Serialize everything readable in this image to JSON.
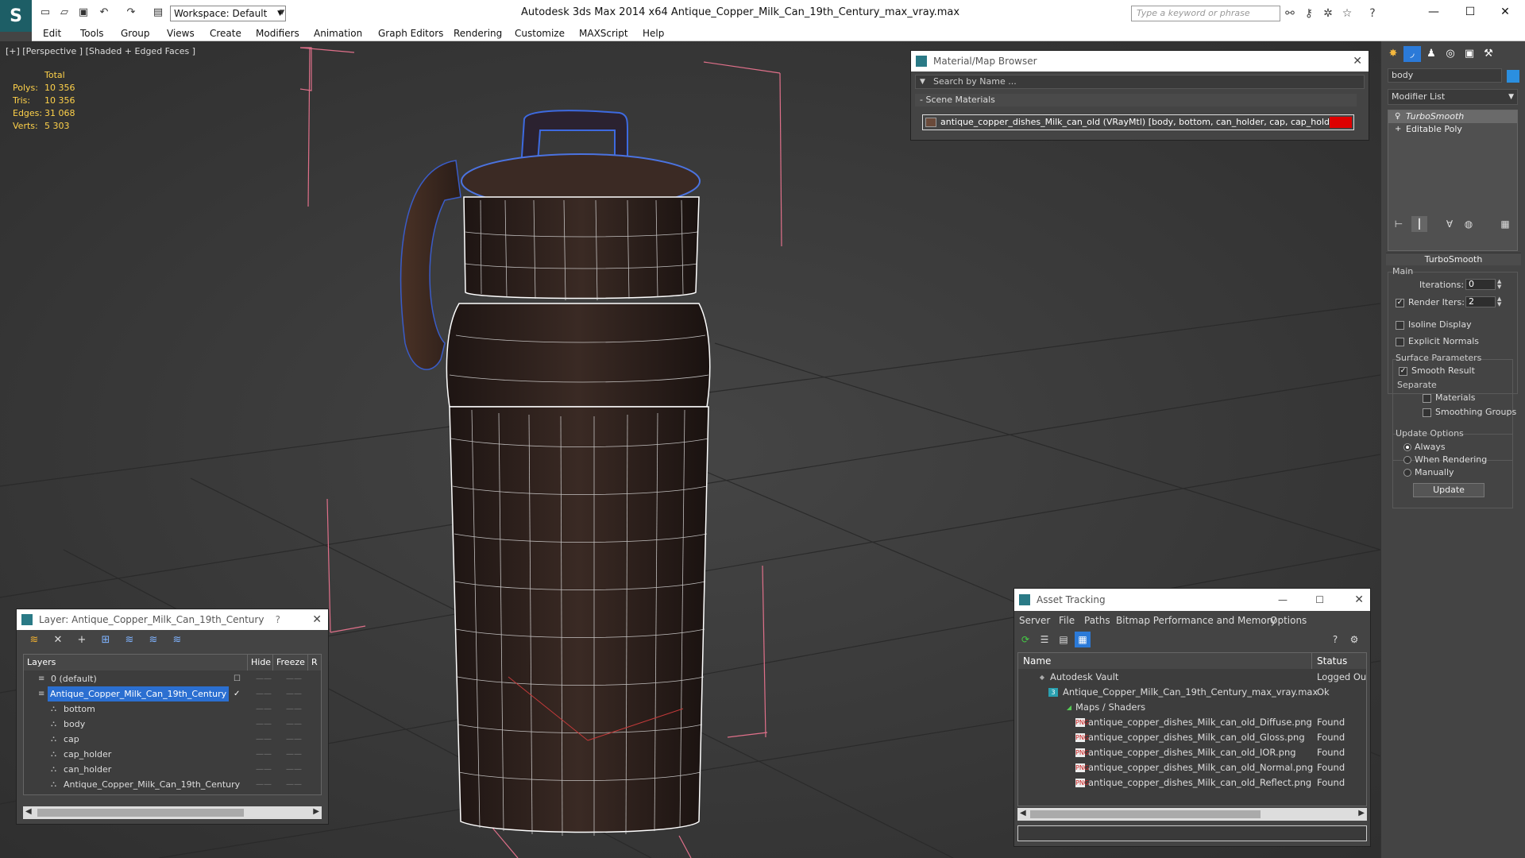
{
  "titlebar": {
    "workspace": "Workspace: Default",
    "app_title": "Autodesk 3ds Max  2014 x64      Antique_Copper_Milk_Can_19th_Century_max_vray.max",
    "search_placeholder": "Type a keyword or phrase"
  },
  "menu": [
    "Edit",
    "Tools",
    "Group",
    "Views",
    "Create",
    "Modifiers",
    "Animation",
    "Graph Editors",
    "Rendering",
    "Customize",
    "MAXScript",
    "Help"
  ],
  "viewport": {
    "label": "[+] [Perspective ] [Shaded + Edged Faces ]",
    "stats": {
      "header": "Total",
      "polys_label": "Polys:",
      "polys": "10 356",
      "tris_label": "Tris:",
      "tris": "10 356",
      "edges_label": "Edges:",
      "edges": "31 068",
      "verts_label": "Verts:",
      "verts": "5 303"
    }
  },
  "material_browser": {
    "title": "Material/Map Browser",
    "search_placeholder": "Search by Name ...",
    "section": "- Scene Materials",
    "material": "antique_copper_dishes_Milk_can_old  (VRayMtl) [body, bottom, can_holder, cap, cap_holder]",
    "swatch_color": "#dd0000"
  },
  "command_panel": {
    "object_name": "body",
    "object_color": "#2b8fe0",
    "modifier_list": "Modifier List",
    "stack": [
      "TurboSmooth",
      "Editable Poly"
    ],
    "rollout": "TurboSmooth",
    "main_label": "Main",
    "iterations_label": "Iterations:",
    "iterations": "0",
    "render_iters_label": "Render Iters:",
    "render_iters": "2",
    "render_iters_checked": true,
    "isoline_label": "Isoline Display",
    "explicit_normals_label": "Explicit Normals",
    "surface_params_label": "Surface Parameters",
    "smooth_result_label": "Smooth Result",
    "smooth_result_checked": true,
    "separate_label": "Separate",
    "materials_label": "Materials",
    "smoothing_groups_label": "Smoothing Groups",
    "update_options_label": "Update Options",
    "always_label": "Always",
    "when_rendering_label": "When Rendering",
    "manually_label": "Manually",
    "update_option_selected": "Always",
    "update_button": "Update"
  },
  "layer_panel": {
    "title": "Layer: Antique_Copper_Milk_Can_19th_Century",
    "help": "?",
    "columns": [
      "Layers",
      "Hide",
      "Freeze",
      "R"
    ],
    "rows": [
      {
        "name": "0 (default)",
        "level": 1,
        "selected": false
      },
      {
        "name": "Antique_Copper_Milk_Can_19th_Century",
        "level": 1,
        "selected": true
      },
      {
        "name": "bottom",
        "level": 2,
        "selected": false
      },
      {
        "name": "body",
        "level": 2,
        "selected": false
      },
      {
        "name": "cap",
        "level": 2,
        "selected": false
      },
      {
        "name": "cap_holder",
        "level": 2,
        "selected": false
      },
      {
        "name": "can_holder",
        "level": 2,
        "selected": false
      },
      {
        "name": "Antique_Copper_Milk_Can_19th_Century",
        "level": 2,
        "selected": false
      }
    ]
  },
  "asset_tracking": {
    "title": "Asset Tracking",
    "menu": [
      "Server",
      "File",
      "Paths",
      "Bitmap Performance and Memory",
      "Options"
    ],
    "columns": [
      "Name",
      "Status"
    ],
    "rows": [
      {
        "name": "Autodesk Vault",
        "status": "Logged Out",
        "level": 1,
        "icon": "vault-icon"
      },
      {
        "name": "Antique_Copper_Milk_Can_19th_Century_max_vray.max",
        "status": "Ok",
        "level": 2,
        "icon": "max-file-icon"
      },
      {
        "name": "Maps / Shaders",
        "status": "",
        "level": 3,
        "icon": "maps-icon"
      },
      {
        "name": "antique_copper_dishes_Milk_can_old_Diffuse.png",
        "status": "Found",
        "level": 4,
        "icon": "png-icon"
      },
      {
        "name": "antique_copper_dishes_Milk_can_old_Gloss.png",
        "status": "Found",
        "level": 4,
        "icon": "png-icon"
      },
      {
        "name": "antique_copper_dishes_Milk_can_old_IOR.png",
        "status": "Found",
        "level": 4,
        "icon": "png-icon"
      },
      {
        "name": "antique_copper_dishes_Milk_can_old_Normal.png",
        "status": "Found",
        "level": 4,
        "icon": "png-icon"
      },
      {
        "name": "antique_copper_dishes_Milk_can_old_Reflect.png",
        "status": "Found",
        "level": 4,
        "icon": "png-icon"
      }
    ]
  }
}
